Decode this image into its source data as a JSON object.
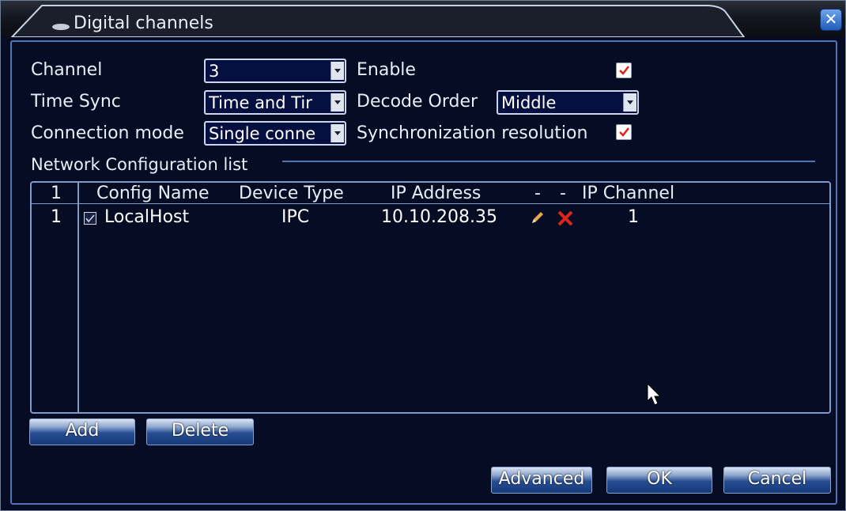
{
  "window": {
    "title": "Digital channels",
    "close_icon": "close-icon"
  },
  "form": {
    "channel_label": "Channel",
    "channel_value": "3",
    "enable_label": "Enable",
    "enable_checked": true,
    "time_sync_label": "Time Sync",
    "time_sync_value": "Time and Tir",
    "decode_order_label": "Decode Order",
    "decode_order_value": "Middle",
    "connection_mode_label": "Connection mode",
    "connection_mode_value": "Single conne",
    "sync_resolution_label": "Synchronization resolution",
    "sync_resolution_checked": true
  },
  "network_list": {
    "title": "Network Configuration list",
    "headers": {
      "index": "1",
      "config_name": "Config Name",
      "device_type": "Device Type",
      "ip_address": "IP Address",
      "dash1": "-",
      "dash2": "-",
      "ip_channel": "IP Channel"
    },
    "rows": [
      {
        "index": "1",
        "checked": true,
        "config_name": "LocalHost",
        "device_type": "IPC",
        "ip_address": "10.10.208.35",
        "edit_icon": "pencil-icon",
        "delete_icon": "red-x-icon",
        "ip_channel": "1"
      }
    ]
  },
  "buttons": {
    "add": "Add",
    "delete": "Delete",
    "advanced": "Advanced",
    "ok": "OK",
    "cancel": "Cancel"
  },
  "colors": {
    "background": "#050c24",
    "frame": "#4d74b3",
    "text": "#e8eef8",
    "check_red": "#e0241b",
    "close_blue": "#2d6fd0"
  }
}
